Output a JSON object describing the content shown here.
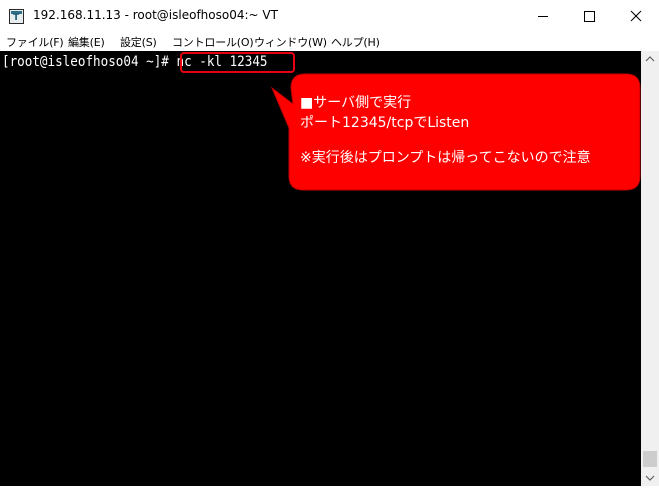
{
  "window": {
    "title": "192.168.11.13 - root@isleofhoso04:~ VT",
    "app_icon_letter": "T",
    "controls": {
      "minimize": "minimize-icon",
      "maximize": "maximize-icon",
      "close": "close-icon"
    }
  },
  "menu": [
    {
      "label": "ファイル(F)"
    },
    {
      "label": "編集(E)"
    },
    {
      "label": "設定(S)"
    },
    {
      "label": "コントロール(O)"
    },
    {
      "label": "ウィンドウ(W)"
    },
    {
      "label": "ヘルプ(H)"
    }
  ],
  "terminal": {
    "prompt": "[root@isleofhoso04 ~]# ",
    "command": "nc -kl 12345",
    "background": "#000000",
    "foreground": "#ffffff"
  },
  "callout": {
    "line1": "■サーバ側で実行",
    "line2": "ポート12345/tcpでListen",
    "line3": "※実行後はプロンプトは帰ってこないので注意",
    "fill_color": "#ff0000",
    "border_color": "#c00000"
  },
  "accent": {
    "highlight_box": "#e60012"
  }
}
